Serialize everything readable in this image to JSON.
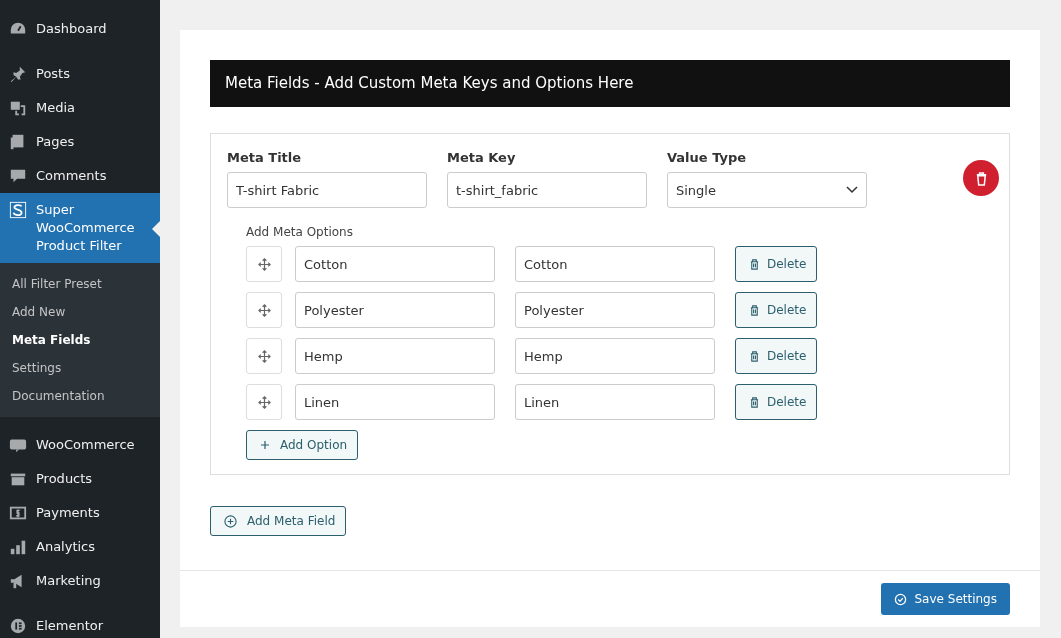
{
  "sidebar": {
    "items": [
      {
        "label": "Dashboard",
        "selected": false
      },
      {
        "label": "Posts",
        "selected": false
      },
      {
        "label": "Media",
        "selected": false
      },
      {
        "label": "Pages",
        "selected": false
      },
      {
        "label": "Comments",
        "selected": false
      },
      {
        "label": "Super WooCommerce Product Filter",
        "selected": true,
        "children": [
          {
            "label": "All Filter Preset",
            "selected": false
          },
          {
            "label": "Add New",
            "selected": false
          },
          {
            "label": "Meta Fields",
            "selected": true
          },
          {
            "label": "Settings",
            "selected": false
          },
          {
            "label": "Documentation",
            "selected": false
          }
        ]
      },
      {
        "label": "WooCommerce",
        "selected": false
      },
      {
        "label": "Products",
        "selected": false
      },
      {
        "label": "Payments",
        "selected": false
      },
      {
        "label": "Analytics",
        "selected": false
      },
      {
        "label": "Marketing",
        "selected": false
      },
      {
        "label": "Elementor",
        "selected": false
      }
    ]
  },
  "header": "Meta Fields - Add Custom Meta Keys and Options Here",
  "meta_field": {
    "title_label": "Meta Title",
    "title_value": "T-shirt Fabric",
    "key_label": "Meta Key",
    "key_value": "t-shirt_fabric",
    "type_label": "Value Type",
    "type_value": "Single",
    "options_label": "Add Meta Options",
    "options": [
      {
        "name": "Cotton",
        "value": "Cotton",
        "delete": "Delete"
      },
      {
        "name": "Polyester",
        "value": "Polyester",
        "delete": "Delete"
      },
      {
        "name": "Hemp",
        "value": "Hemp",
        "delete": "Delete"
      },
      {
        "name": "Linen",
        "value": "Linen",
        "delete": "Delete"
      }
    ],
    "add_option": "Add Option"
  },
  "add_meta_field": "Add Meta Field",
  "save_button": "Save Settings"
}
